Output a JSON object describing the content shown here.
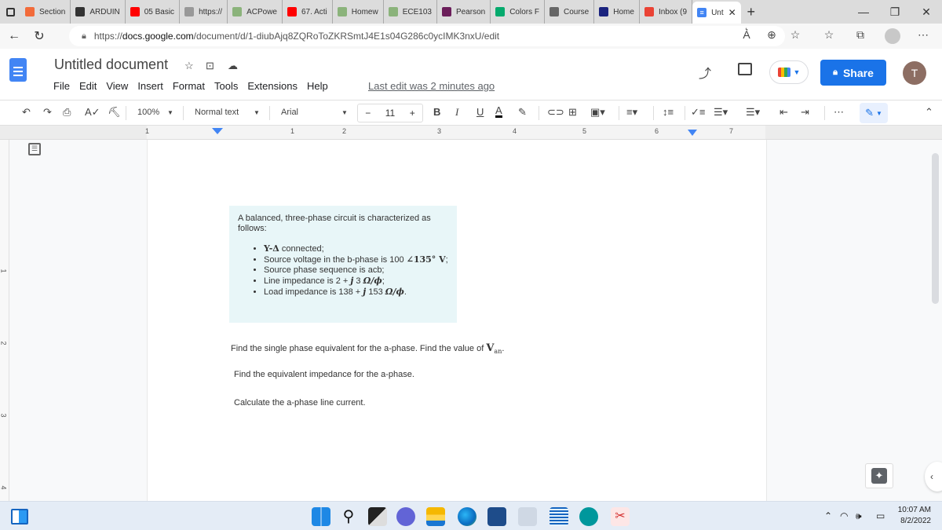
{
  "browser": {
    "tabs": [
      {
        "label": "Section",
        "icon": "zybooks-icon",
        "color": "#f26b3a"
      },
      {
        "label": "ARDUIN",
        "icon": "arduino-icon",
        "color": "#333333"
      },
      {
        "label": "05 Basic",
        "icon": "youtube-icon",
        "color": "#ff0000"
      },
      {
        "label": "https://",
        "icon": "page-icon",
        "color": "#999999"
      },
      {
        "label": "ACPowe",
        "icon": "leaf-icon",
        "color": "#8bb37b"
      },
      {
        "label": "67. Acti",
        "icon": "youtube-icon",
        "color": "#ff0000"
      },
      {
        "label": "Homew",
        "icon": "leaf-icon",
        "color": "#8bb37b"
      },
      {
        "label": "ECE103",
        "icon": "leaf-icon",
        "color": "#8bb37b"
      },
      {
        "label": "Pearson",
        "icon": "pearson-icon",
        "color": "#6b1e5a"
      },
      {
        "label": "Colors F",
        "icon": "w3schools-icon",
        "color": "#04aa6d"
      },
      {
        "label": "Course",
        "icon": "book-icon",
        "color": "#666666"
      },
      {
        "label": "Home",
        "icon": "bartleby-icon",
        "color": "#1a237e"
      },
      {
        "label": "Inbox (9",
        "icon": "gmail-icon",
        "color": "#ea4335"
      }
    ],
    "active_tab": {
      "label": "Unt",
      "icon": "docs-icon",
      "close": "✕"
    },
    "new_tab": "+",
    "window_controls": {
      "minimize": "—",
      "restore": "❐",
      "close": "✕"
    },
    "url_prefix": "https://",
    "url_domain": "docs.google.com",
    "url_path": "/document/d/1-diubAjq8ZQRoToZKRSmtJ4E1s04G286c0ycIMK3nxU/edit"
  },
  "docs": {
    "title": "Untitled document",
    "menu": [
      "File",
      "Edit",
      "View",
      "Insert",
      "Format",
      "Tools",
      "Extensions",
      "Help"
    ],
    "last_edit": "Last edit was 2 minutes ago",
    "share_label": "Share",
    "avatar_letter": "T",
    "toolbar": {
      "zoom": "100%",
      "style": "Normal text",
      "font": "Arial",
      "font_size": "11",
      "minus": "−",
      "plus": "+",
      "bold": "B",
      "italic": "I",
      "underline": "U",
      "text_color": "A",
      "more": "⋯"
    },
    "ruler_numbers": [
      "1",
      "1",
      "2",
      "3",
      "4",
      "5",
      "6",
      "7"
    ],
    "vruler_numbers": [
      "1",
      "2",
      "3",
      "4"
    ]
  },
  "document": {
    "intro": "A balanced, three-phase circuit is characterized as follows:",
    "bullets": [
      {
        "math": "Y-Δ",
        "text": " connected;"
      },
      {
        "text": "Source voltage in the b-phase is 100 ",
        "math": "∠135°  V",
        "tail": ";"
      },
      {
        "text": "Source phase sequence is acb;"
      },
      {
        "text": "Line impedance is 2 + ",
        "math": "j",
        "text2": " 3 ",
        "math2": "Ω/ϕ",
        "tail": ";"
      },
      {
        "text": "Load impedance is 138 + ",
        "math": "j",
        "text2": " 153 ",
        "math2": "Ω/ϕ",
        "tail": "."
      }
    ],
    "q1": "Find the single phase equivalent for the a-phase. Find the value of ",
    "q1_math": "V",
    "q1_sub": "an",
    "q1_tail": ".",
    "q2": "Find the equivalent impedance for the a-phase.",
    "q3": "Calculate the a-phase line current."
  },
  "taskbar": {
    "time": "10:07 AM",
    "date": "8/2/2022"
  }
}
